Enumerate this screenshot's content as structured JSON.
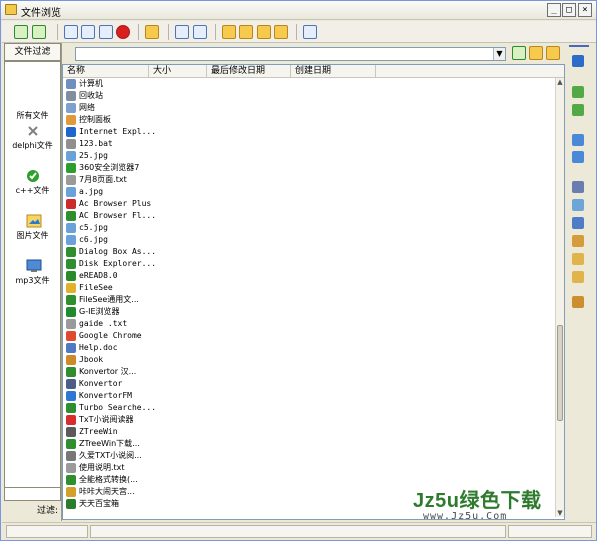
{
  "window": {
    "title": "文件浏览",
    "controls": [
      "_",
      "□",
      "×"
    ]
  },
  "toolbar": {
    "icons": [
      "refresh-icon",
      "refresh-2-icon",
      "document-c-icon",
      "document-u-icon",
      "document-p-icon",
      "delete-icon",
      "folder-open-icon",
      "page-blue-icon",
      "page-red-icon",
      "folder-1-icon",
      "folder-2-icon",
      "folder-3-icon",
      "folder-4-icon",
      "export-icon"
    ]
  },
  "left_panel": {
    "tab_label": "文件过滤",
    "items": [
      {
        "label": "所有文件",
        "icon": "blank-icon"
      },
      {
        "label": "delphi文件",
        "icon": "close-x-icon"
      },
      {
        "label": "c++文件",
        "icon": "check-circle-icon"
      },
      {
        "label": "图片文件",
        "icon": "image-icon"
      },
      {
        "label": "mp3文件",
        "icon": "monitor-icon"
      }
    ],
    "filter_label": "过滤:"
  },
  "pathbar": {
    "value": "",
    "icons": [
      "go-icon",
      "folder-add-icon",
      "folder-icon"
    ]
  },
  "list": {
    "columns": [
      "名称",
      "大小",
      "最后修改日期",
      "创建日期"
    ],
    "rows": [
      {
        "name": "计算机",
        "icon": "computer-icon",
        "color": "#6f8fbf"
      },
      {
        "name": "回收站",
        "icon": "recycle-icon",
        "color": "#7f8f9f"
      },
      {
        "name": "网络",
        "icon": "network-icon",
        "color": "#7f9fcf"
      },
      {
        "name": "控制面板",
        "icon": "control-panel-icon",
        "color": "#e09a3a"
      },
      {
        "name": "Internet Expl...",
        "icon": "ie-icon",
        "color": "#1f66cc"
      },
      {
        "name": "123.bat",
        "icon": "bat-icon",
        "color": "#8f8f8f"
      },
      {
        "name": "25.jpg",
        "icon": "jpg-icon",
        "color": "#6aa1d9"
      },
      {
        "name": "360安全浏览器7",
        "icon": "browser-icon",
        "color": "#2d9d2d"
      },
      {
        "name": "7月8页面.txt",
        "icon": "txt-icon",
        "color": "#9a9a9a"
      },
      {
        "name": "a.jpg",
        "icon": "jpg-icon",
        "color": "#6aa1d9"
      },
      {
        "name": "Ac Browser Plus",
        "icon": "ac-browser-icon",
        "color": "#cc2b2b"
      },
      {
        "name": "AC Browser Fl...",
        "icon": "number-6-icon",
        "color": "#2f8f2f"
      },
      {
        "name": "c5.jpg",
        "icon": "jpg-icon",
        "color": "#6aa1d9"
      },
      {
        "name": "c6.jpg",
        "icon": "jpg-icon",
        "color": "#6aa1d9"
      },
      {
        "name": "Dialog Box As...",
        "icon": "number-6-icon",
        "color": "#2f8f2f"
      },
      {
        "name": "Disk Explorer...",
        "icon": "number-6-icon",
        "color": "#2f8f2f"
      },
      {
        "name": "eREAD8.0",
        "icon": "read-icon",
        "color": "#2a8a2a"
      },
      {
        "name": "FileSee",
        "icon": "file-see-icon",
        "color": "#e0b12a"
      },
      {
        "name": "FileSee通用文...",
        "icon": "number-6-icon",
        "color": "#2f8f2f"
      },
      {
        "name": "G-IE浏览器",
        "icon": "gie-icon",
        "color": "#1f8b2a"
      },
      {
        "name": "gaide .txt",
        "icon": "txt-icon",
        "color": "#9a9a9a"
      },
      {
        "name": "Google Chrome",
        "icon": "chrome-icon",
        "color": "#e04b2d"
      },
      {
        "name": "Help.doc",
        "icon": "doc-icon",
        "color": "#4f79c5"
      },
      {
        "name": "Jbook",
        "icon": "jbook-icon",
        "color": "#cc8a2a"
      },
      {
        "name": "Konvertor 汉...",
        "icon": "number-6-icon",
        "color": "#2f8f2f"
      },
      {
        "name": "Konvertor",
        "icon": "k-icon",
        "color": "#4d5d86"
      },
      {
        "name": "KonvertorFM",
        "icon": "circle-icon",
        "color": "#2f78d1"
      },
      {
        "name": "Turbo Searche...",
        "icon": "number-6-icon",
        "color": "#2f8f2f"
      },
      {
        "name": "TxT小说阅读器",
        "icon": "r-icon",
        "color": "#d82d2d"
      },
      {
        "name": "ZTreeWin",
        "icon": "ztreewin-icon",
        "color": "#5a5a5a"
      },
      {
        "name": "ZTreeWin下载...",
        "icon": "number-6-icon",
        "color": "#2f8f2f"
      },
      {
        "name": "久爱TXT小说阅...",
        "icon": "book-icon",
        "color": "#777"
      },
      {
        "name": "使用说明.txt",
        "icon": "txt-icon",
        "color": "#9a9a9a"
      },
      {
        "name": "全能格式转换(...",
        "icon": "number-6-icon",
        "color": "#2f8f2f"
      },
      {
        "name": "咔咔大闹天宫...",
        "icon": "game-icon",
        "color": "#d3a12a"
      },
      {
        "name": "天天百宝箱",
        "icon": "x-box-icon",
        "color": "#2b7c2b"
      }
    ]
  },
  "right_rail": {
    "icons": [
      "info-icon",
      "forward-icon",
      "back-icon",
      "branch-icon",
      "merge-icon",
      "window-icon",
      "properties-icon",
      "save-icon",
      "pack-icon",
      "mail-icon",
      "export-icon",
      "edit-icon"
    ]
  },
  "watermark": {
    "main": "Jz5u绿色下载",
    "sub": "www.Jz5u.Com"
  }
}
